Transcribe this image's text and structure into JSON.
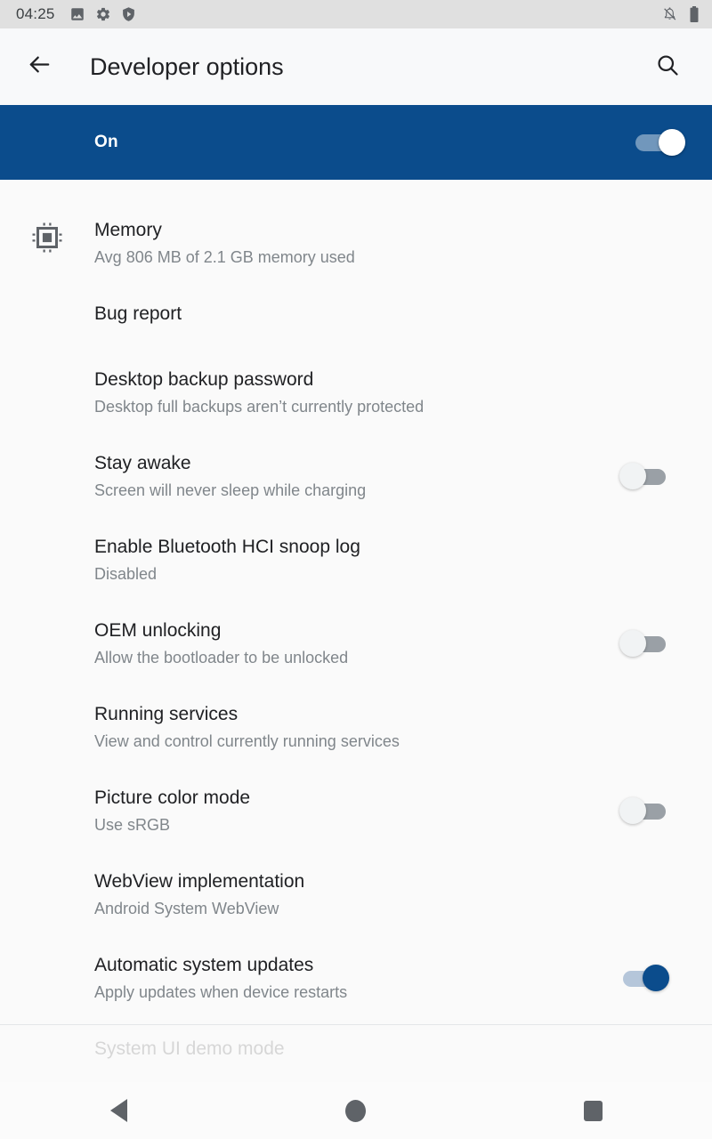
{
  "status_bar": {
    "clock": "04:25",
    "left_icons": [
      "image-icon",
      "gear-icon",
      "shield-play-icon"
    ],
    "right_icons": [
      "notifications-off-icon",
      "battery-icon"
    ]
  },
  "toolbar": {
    "back_icon": "back-arrow-icon",
    "title": "Developer options",
    "search_icon": "search-icon"
  },
  "master_switch": {
    "label": "On",
    "state": "on",
    "bar_color": "#0b4c8c"
  },
  "settings": [
    {
      "title": "Memory",
      "summary": "Avg 806 MB of 2.1 GB memory used",
      "icon": "memory-chip-icon",
      "control": "none"
    },
    {
      "title": "Bug report",
      "summary": "",
      "icon": "",
      "control": "none"
    },
    {
      "title": "Desktop backup password",
      "summary": "Desktop full backups aren’t currently protected",
      "icon": "",
      "control": "none"
    },
    {
      "title": "Stay awake",
      "summary": "Screen will never sleep while charging",
      "icon": "",
      "control": "switch-off"
    },
    {
      "title": "Enable Bluetooth HCI snoop log",
      "summary": "Disabled",
      "icon": "",
      "control": "none"
    },
    {
      "title": "OEM unlocking",
      "summary": "Allow the bootloader to be unlocked",
      "icon": "",
      "control": "switch-off"
    },
    {
      "title": "Running services",
      "summary": "View and control currently running services",
      "icon": "",
      "control": "none"
    },
    {
      "title": "Picture color mode",
      "summary": "Use sRGB",
      "icon": "",
      "control": "switch-off"
    },
    {
      "title": "WebView implementation",
      "summary": "Android System WebView",
      "icon": "",
      "control": "none"
    },
    {
      "title": "Automatic system updates",
      "summary": "Apply updates when device restarts",
      "icon": "",
      "control": "switch-on"
    },
    {
      "title": "System UI demo mode",
      "summary": "",
      "icon": "",
      "control": "none"
    }
  ],
  "nav_bar": {
    "back_label": "Back",
    "home_label": "Home",
    "recents_label": "Recents"
  }
}
